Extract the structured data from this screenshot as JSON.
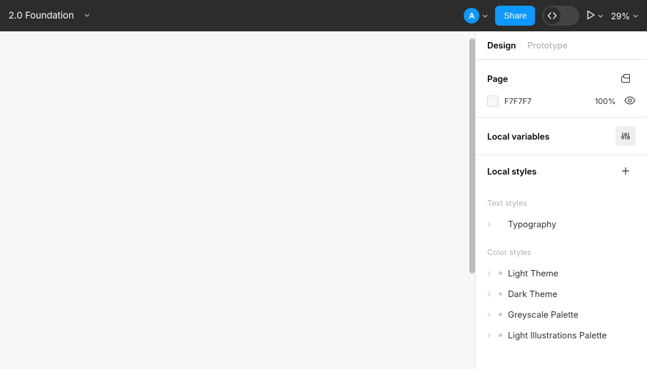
{
  "header": {
    "file_name": "2.0 Foundation",
    "avatar_letter": "A",
    "share_label": "Share",
    "zoom": "29%"
  },
  "panel": {
    "tabs": {
      "design": "Design",
      "prototype": "Prototype"
    },
    "page": {
      "title": "Page",
      "bg_hex": "F7F7F7",
      "bg_opacity": "100%"
    },
    "local_variables": {
      "title": "Local variables"
    },
    "local_styles": {
      "title": "Local styles",
      "text_styles_label": "Text styles",
      "text_styles": [
        {
          "name": "Typography"
        }
      ],
      "color_styles_label": "Color styles",
      "color_styles": [
        {
          "name": "Light Theme"
        },
        {
          "name": "Dark Theme"
        },
        {
          "name": "Greyscale Palette"
        },
        {
          "name": "Light Illustrations Palette"
        }
      ]
    }
  }
}
